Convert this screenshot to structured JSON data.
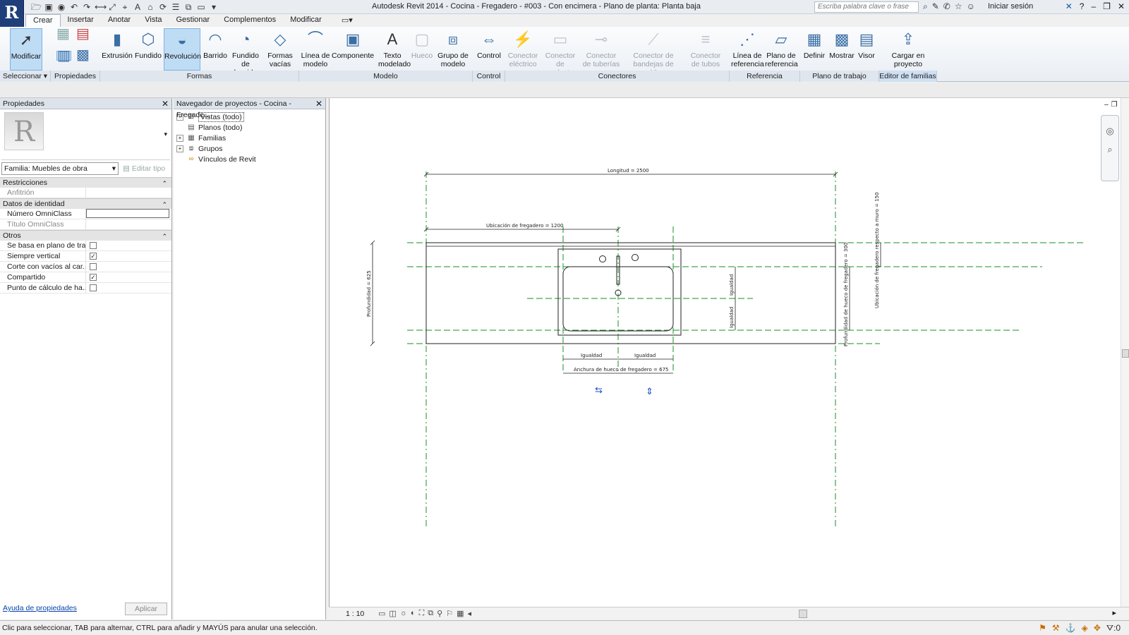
{
  "window": {
    "title": "Autodesk Revit 2014 -     Cocina - Fregadero - #003 - Con encimera - Plano de planta: Planta baja",
    "search_placeholder": "Escriba palabra clave o frase",
    "login_label": "Iniciar sesión",
    "help_label": "?"
  },
  "tabs": [
    "Crear",
    "Insertar",
    "Anotar",
    "Vista",
    "Gestionar",
    "Complementos",
    "Modificar"
  ],
  "ribbon": {
    "buttons": {
      "modificar": "Modificar",
      "extrusion": "Extrusión",
      "fundido": "Fundido",
      "revolucion": "Revolución",
      "barrido": "Barrido",
      "fundido_barrido": "Fundido de barrido",
      "formas_vacias": "Formas vacías",
      "linea_modelo": "Línea de modelo",
      "componente": "Componente",
      "texto_modelado": "Texto modelado",
      "hueco": "Hueco",
      "grupo_modelo": "Grupo de modelo",
      "control": "Control",
      "conector_electrico": "Conector eléctrico",
      "conector_conductos": "Conector de conductos",
      "conector_tuberias": "Conector de tuberías",
      "conector_bandejas": "Conector de bandejas de cables",
      "conector_tubos": "Conector de tubos",
      "linea_referencia": "Línea de referencia",
      "plano_referencia": "Plano de referencia",
      "definir": "Definir",
      "mostrar": "Mostrar",
      "visor": "Visor",
      "cargar_proyecto": "Cargar en proyecto"
    },
    "panels": {
      "seleccionar": "Seleccionar",
      "propiedades": "Propiedades",
      "formas": "Formas",
      "modelo": "Modelo",
      "control": "Control",
      "conectores": "Conectores",
      "referencia": "Referencia",
      "plano_trabajo": "Plano de trabajo",
      "editor_familias": "Editor de familias"
    }
  },
  "properties": {
    "title": "Propiedades",
    "family_selector": "Familia: Muebles de obra",
    "edit_type": "Editar tipo",
    "sections": {
      "restricciones": "Restricciones",
      "identidad": "Datos de identidad",
      "otros": "Otros"
    },
    "rows": {
      "anfitrion": "Anfitrión",
      "omniclass_num": "Número OmniClass",
      "omniclass_title": "Título OmniClass",
      "plano_trabajo": "Se basa en plano de tra...",
      "siempre_vertical": "Siempre vertical",
      "corte_vacios": "Corte con vacíos al car...",
      "compartido": "Compartido",
      "punto_calculo": "Punto de cálculo de ha..."
    },
    "help_link": "Ayuda de propiedades",
    "apply": "Aplicar"
  },
  "browser": {
    "title": "Navegador de proyectos - Cocina - Fregade...",
    "items": [
      "Vistas (todo)",
      "Planos (todo)",
      "Familias",
      "Grupos",
      "Vínculos de Revit"
    ]
  },
  "drawing": {
    "dims": {
      "longitud": "Longitud = 2500",
      "ubicacion": "Ubicación de fregadero = 1200",
      "profundidad": "Profundidad = 625",
      "igualdad": "Igualdad",
      "anchura_hueco": "Anchura de hueco de fregadero = 675",
      "prof_hueco": "Profundidad de hueco de fregadero = 300",
      "ubic_muro": "Ubicación de fregadero respecto a muro = 150"
    }
  },
  "view_control": {
    "scale": "1 : 10"
  },
  "status": {
    "text": "Clic para seleccionar, TAB para alternar, CTRL para añadir y MAYÚS para anular una selección.",
    "filter_count": ":0"
  }
}
